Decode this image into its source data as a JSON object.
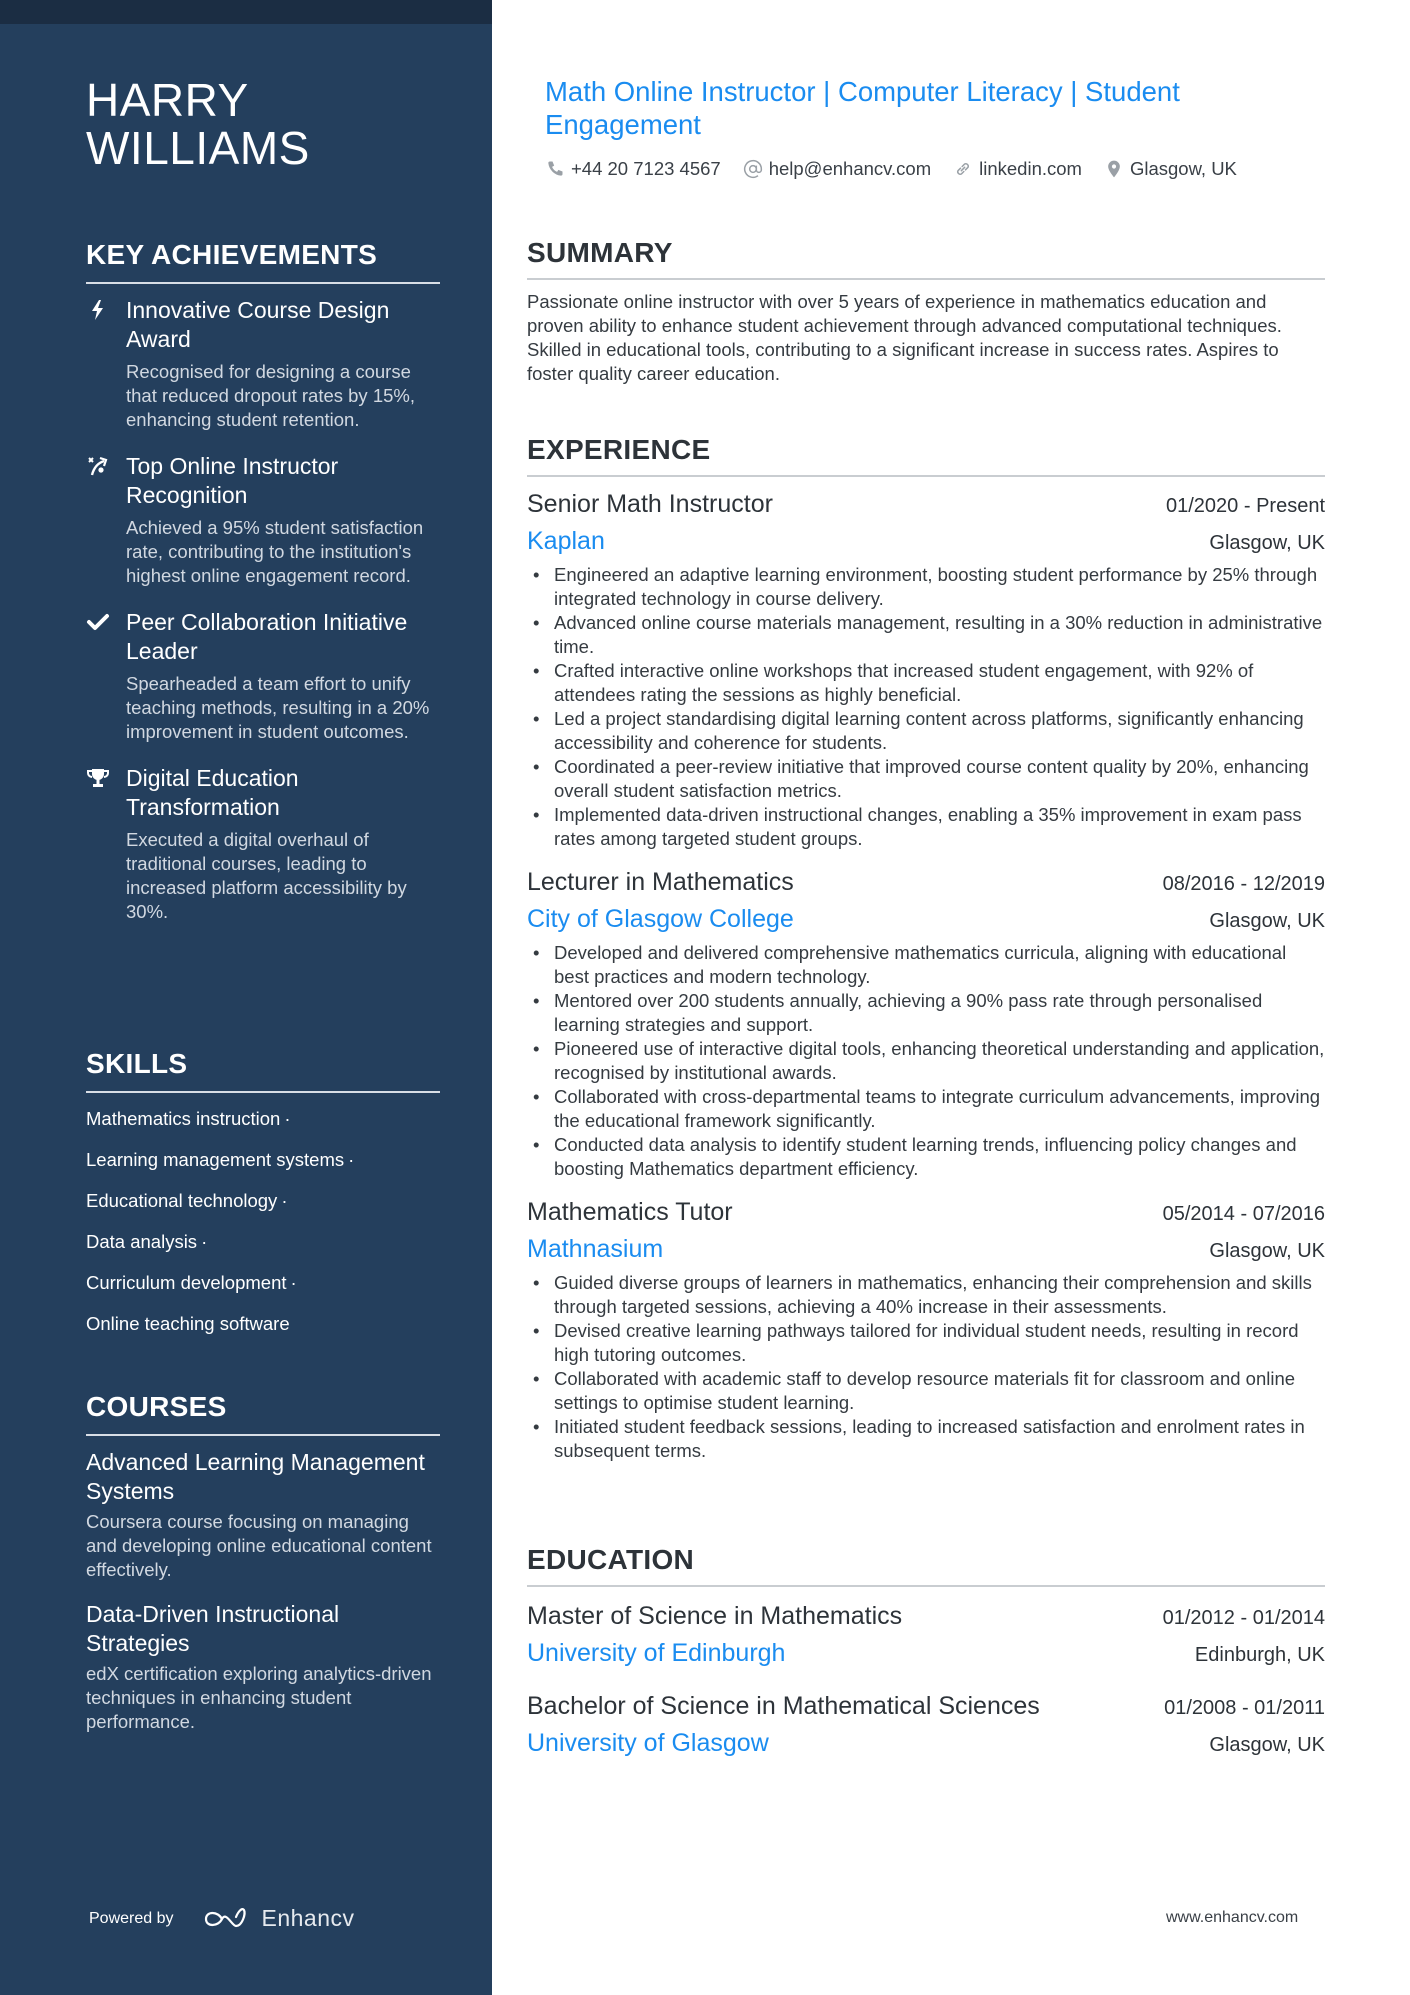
{
  "sidebar": {
    "name": "HARRY WILLIAMS",
    "achievements_heading": "KEY ACHIEVEMENTS",
    "achievements": [
      {
        "icon": "lightning-bolt-icon",
        "title": "Innovative Course Design Award",
        "description": "Recognised for designing a course that reduced dropout rates by 15%, enhancing student retention."
      },
      {
        "icon": "route-arrow-icon",
        "title": "Top Online Instructor Recognition",
        "description": "Achieved a 95% student satisfaction rate, contributing to the institution's highest online engagement record."
      },
      {
        "icon": "checkmark-icon",
        "title": "Peer Collaboration Initiative Leader",
        "description": "Spearheaded a team effort to unify teaching methods, resulting in a 20% improvement in student outcomes."
      },
      {
        "icon": "trophy-icon",
        "title": "Digital Education Transformation",
        "description": "Executed a digital overhaul of traditional courses, leading to increased platform accessibility by 30%."
      }
    ],
    "skills_heading": "SKILLS",
    "skills": [
      {
        "label": "Mathematics instruction",
        "sep": "·"
      },
      {
        "label": "Learning management systems",
        "sep": "·"
      },
      {
        "label": "Educational technology",
        "sep": "·"
      },
      {
        "label": "Data analysis",
        "sep": "·"
      },
      {
        "label": "Curriculum development",
        "sep": "·"
      },
      {
        "label": "Online teaching software",
        "sep": ""
      }
    ],
    "courses_heading": "COURSES",
    "courses": [
      {
        "title": "Advanced Learning Management Systems",
        "description": "Coursera course focusing on managing and developing online educational content effectively."
      },
      {
        "title": "Data-Driven Instructional Strategies",
        "description": "edX certification exploring analytics-driven techniques in enhancing student performance."
      }
    ],
    "powered_by": "Powered by",
    "brand": "Enhancv"
  },
  "header": {
    "headline": "Math Online Instructor | Computer Literacy | Student Engagement",
    "contacts": [
      {
        "icon": "phone-icon",
        "text": "+44 20 7123 4567"
      },
      {
        "icon": "at-sign-icon",
        "text": "help@enhancv.com"
      },
      {
        "icon": "link-icon",
        "text": "linkedin.com"
      },
      {
        "icon": "location-pin-icon",
        "text": "Glasgow, UK"
      }
    ]
  },
  "summary": {
    "heading": "SUMMARY",
    "text": "Passionate online instructor with over 5 years of experience in mathematics education and proven ability to enhance student achievement through advanced computational techniques. Skilled in educational tools, contributing to a significant increase in success rates. Aspires to foster quality career education."
  },
  "experience": {
    "heading": "EXPERIENCE",
    "items": [
      {
        "title": "Senior Math Instructor",
        "dates": "01/2020 - Present",
        "company": "Kaplan",
        "location": "Glasgow, UK",
        "bullets": [
          "Engineered an adaptive learning environment, boosting student performance by 25% through integrated technology in course delivery.",
          "Advanced online course materials management, resulting in a 30% reduction in administrative time.",
          "Crafted interactive online workshops that increased student engagement, with 92% of attendees rating the sessions as highly beneficial.",
          "Led a project standardising digital learning content across platforms, significantly enhancing accessibility and coherence for students.",
          "Coordinated a peer-review initiative that improved course content quality by 20%, enhancing overall student satisfaction metrics.",
          "Implemented data-driven instructional changes, enabling a 35% improvement in exam pass rates among targeted student groups."
        ]
      },
      {
        "title": "Lecturer in Mathematics",
        "dates": "08/2016 - 12/2019",
        "company": "City of Glasgow College",
        "location": "Glasgow, UK",
        "bullets": [
          "Developed and delivered comprehensive mathematics curricula, aligning with educational best practices and modern technology.",
          "Mentored over 200 students annually, achieving a 90% pass rate through personalised learning strategies and support.",
          "Pioneered use of interactive digital tools, enhancing theoretical understanding and application, recognised by institutional awards.",
          "Collaborated with cross-departmental teams to integrate curriculum advancements, improving the educational framework significantly.",
          "Conducted data analysis to identify student learning trends, influencing policy changes and boosting Mathematics department efficiency."
        ]
      },
      {
        "title": "Mathematics Tutor",
        "dates": "05/2014 - 07/2016",
        "company": "Mathnasium",
        "location": "Glasgow, UK",
        "bullets": [
          "Guided diverse groups of learners in mathematics, enhancing their comprehension and skills through targeted sessions, achieving a 40% increase in their assessments.",
          "Devised creative learning pathways tailored for individual student needs, resulting in record high tutoring outcomes.",
          "Collaborated with academic staff to develop resource materials fit for classroom and online settings to optimise student learning.",
          "Initiated student feedback sessions, leading to increased satisfaction and enrolment rates in subsequent terms."
        ]
      }
    ]
  },
  "education": {
    "heading": "EDUCATION",
    "items": [
      {
        "degree": "Master of Science in Mathematics",
        "dates": "01/2012 - 01/2014",
        "school": "University of Edinburgh",
        "location": "Edinburgh, UK"
      },
      {
        "degree": "Bachelor of Science in Mathematical Sciences",
        "dates": "01/2008 - 01/2011",
        "school": "University of Glasgow",
        "location": "Glasgow, UK"
      }
    ]
  },
  "footer": {
    "url": "www.enhancv.com"
  },
  "colors": {
    "sidebar_bg": "#243f5d",
    "accent_blue": "#1a8cf0",
    "text_dark": "#2d3339"
  }
}
